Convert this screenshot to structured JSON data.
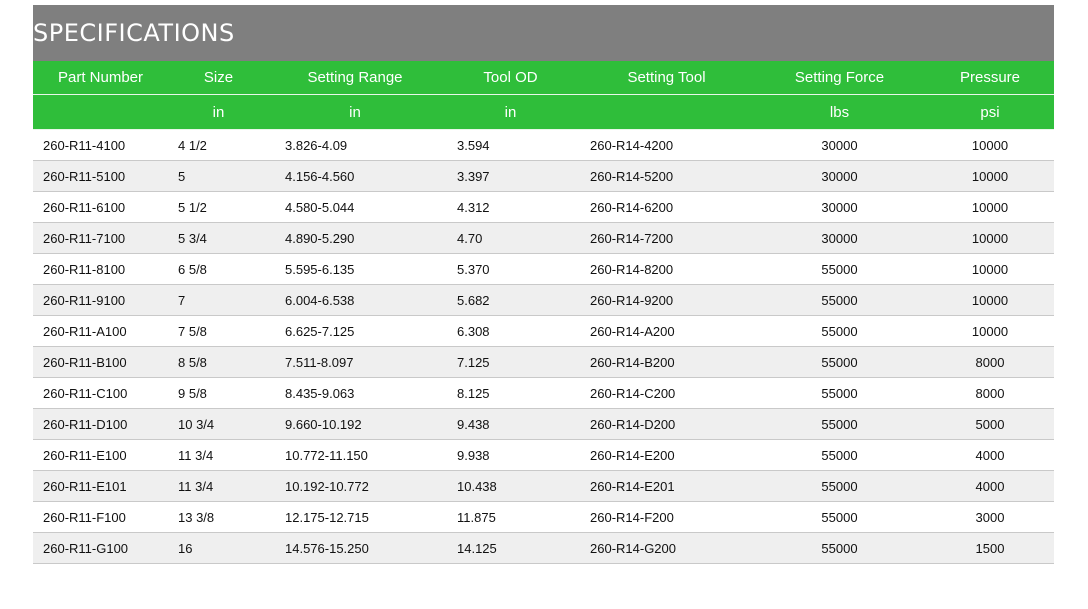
{
  "title": "SPECIFICATIONS",
  "header": {
    "columns": [
      "Part Number",
      "Size",
      "Setting Range",
      "Tool OD",
      "Setting Tool",
      "Setting Force",
      "Pressure"
    ],
    "units": [
      "",
      "in",
      "in",
      "in",
      "",
      "lbs",
      "psi"
    ]
  },
  "rows": [
    [
      "260-R11-4100",
      "4 1/2",
      "3.826-4.09",
      "3.594",
      "260-R14-4200",
      "30000",
      "10000"
    ],
    [
      "260-R11-5100",
      "5",
      "4.156-4.560",
      "3.397",
      "260-R14-5200",
      "30000",
      "10000"
    ],
    [
      "260-R11-6100",
      "5 1/2",
      "4.580-5.044",
      "4.312",
      "260-R14-6200",
      "30000",
      "10000"
    ],
    [
      "260-R11-7100",
      "5 3/4",
      "4.890-5.290",
      "4.70",
      "260-R14-7200",
      "30000",
      "10000"
    ],
    [
      "260-R11-8100",
      "6 5/8",
      "5.595-6.135",
      "5.370",
      "260-R14-8200",
      "55000",
      "10000"
    ],
    [
      "260-R11-9100",
      "7",
      "6.004-6.538",
      "5.682",
      "260-R14-9200",
      "55000",
      "10000"
    ],
    [
      "260-R11-A100",
      "7 5/8",
      "6.625-7.125",
      "6.308",
      "260-R14-A200",
      "55000",
      "10000"
    ],
    [
      "260-R11-B100",
      "8 5/8",
      "7.511-8.097",
      "7.125",
      "260-R14-B200",
      "55000",
      "8000"
    ],
    [
      "260-R11-C100",
      "9 5/8",
      "8.435-9.063",
      "8.125",
      "260-R14-C200",
      "55000",
      "8000"
    ],
    [
      "260-R11-D100",
      "10 3/4",
      "9.660-10.192",
      "9.438",
      "260-R14-D200",
      "55000",
      "5000"
    ],
    [
      "260-R11-E100",
      "11 3/4",
      "10.772-11.150",
      "9.938",
      "260-R14-E200",
      "55000",
      "4000"
    ],
    [
      "260-R11-E101",
      "11 3/4",
      "10.192-10.772",
      "10.438",
      "260-R14-E201",
      "55000",
      "4000"
    ],
    [
      "260-R11-F100",
      "13 3/8",
      "12.175-12.715",
      "11.875",
      "260-R14-F200",
      "55000",
      "3000"
    ],
    [
      "260-R11-G100",
      "16",
      "14.576-15.250",
      "14.125",
      "260-R14-G200",
      "55000",
      "1500"
    ]
  ],
  "colors": {
    "title_bg": "#7f7f7f",
    "header_bg": "#2fbe3a",
    "alt_row_bg": "#efefef"
  }
}
